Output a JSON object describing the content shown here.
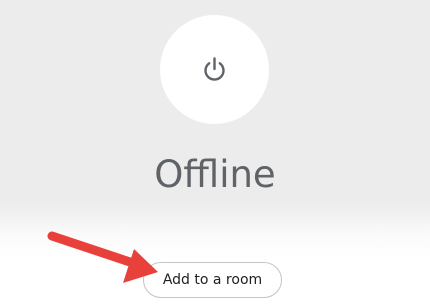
{
  "device": {
    "status": "Offline",
    "status_icon": "power-icon"
  },
  "actions": {
    "add_room_label": "Add to a room"
  },
  "annotation": {
    "icon": "red-arrow-icon",
    "color": "#e8413b"
  }
}
